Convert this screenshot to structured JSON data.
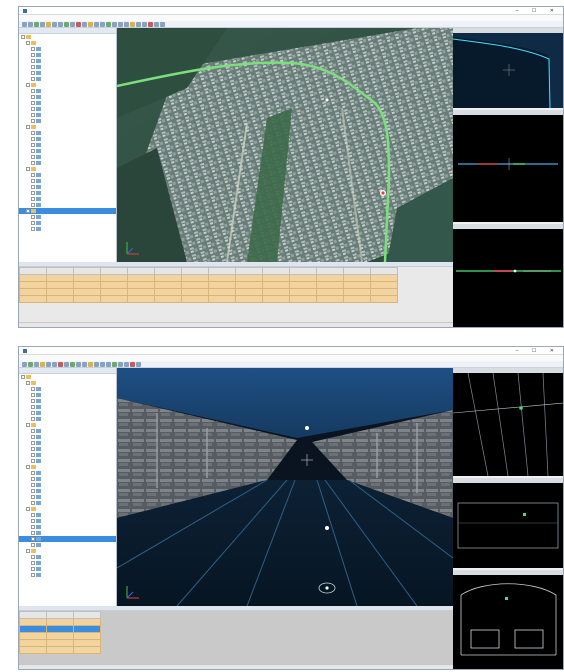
{
  "colors": {
    "route_line": "#7be07b",
    "selection": "#3b8de0",
    "grid_row": "#f3d39e",
    "cyan_line": "#40e0ff"
  },
  "window1": {
    "title": "",
    "tree_nodes": [
      "",
      "",
      "",
      "",
      "",
      "",
      "",
      "",
      "",
      "",
      "",
      "",
      "",
      "",
      "",
      "",
      "",
      "",
      "",
      "",
      "",
      "",
      "",
      "",
      "",
      "",
      "",
      "",
      "",
      "",
      "",
      "",
      ""
    ],
    "selected_index": 29,
    "side_panels": [
      {
        "title": ""
      },
      {
        "title": ""
      },
      {
        "title": ""
      }
    ],
    "table_columns": [
      "",
      "",
      "",
      "",
      "",
      "",
      "",
      "",
      "",
      "",
      "",
      "",
      "",
      ""
    ],
    "table_rows": [
      [
        "",
        "",
        "",
        "",
        "",
        "",
        "",
        "",
        "",
        "",
        "",
        "",
        "",
        ""
      ],
      [
        "",
        "",
        "",
        "",
        "",
        "",
        "",
        "",
        "",
        "",
        "",
        "",
        "",
        ""
      ],
      [
        "",
        "",
        "",
        "",
        "",
        "",
        "",
        "",
        "",
        "",
        "",
        "",
        "",
        ""
      ],
      [
        "",
        "",
        "",
        "",
        "",
        "",
        "",
        "",
        "",
        "",
        "",
        "",
        "",
        ""
      ]
    ],
    "status": ""
  },
  "window2": {
    "title": "",
    "tree_nodes": [
      "",
      "",
      "",
      "",
      "",
      "",
      "",
      "",
      "",
      "",
      "",
      "",
      "",
      "",
      "",
      "",
      "",
      "",
      "",
      "",
      "",
      "",
      "",
      "",
      "",
      "",
      "",
      "",
      "",
      "",
      "",
      "",
      "",
      ""
    ],
    "selected_index": 27,
    "side_panels": [
      {
        "title": ""
      },
      {
        "title": ""
      },
      {
        "title": ""
      }
    ],
    "table_columns": [
      "",
      "",
      ""
    ],
    "table_rows": [
      [
        "",
        "",
        ""
      ],
      [
        "",
        "",
        ""
      ],
      [
        "",
        "",
        ""
      ],
      [
        "",
        "",
        ""
      ],
      [
        "",
        "",
        ""
      ]
    ],
    "status": ""
  }
}
